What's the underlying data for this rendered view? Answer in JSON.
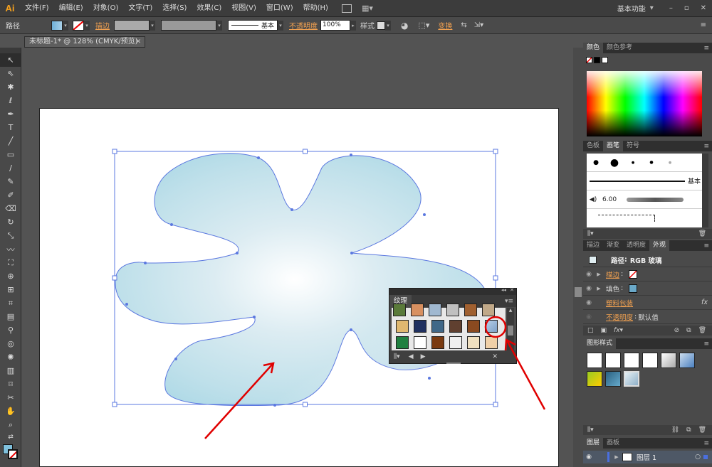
{
  "app": {
    "logo": "Ai",
    "workspace": "基本功能"
  },
  "menu": [
    "文件(F)",
    "编辑(E)",
    "对象(O)",
    "文字(T)",
    "选择(S)",
    "效果(C)",
    "视图(V)",
    "窗口(W)",
    "帮助(H)"
  ],
  "control": {
    "object_type": "路径",
    "stroke_label": "描边",
    "stroke_profile": "基本",
    "opacity_label": "不透明度",
    "opacity_value": "100%",
    "style_label": "样式",
    "transform_label": "变换"
  },
  "document": {
    "tab_title": "未标题-1* @ 128% (CMYK/预览)"
  },
  "color_panel": {
    "tabs": [
      "颜色",
      "颜色参考"
    ]
  },
  "brush_panel": {
    "tabs": [
      "色板",
      "画笔",
      "符号"
    ],
    "basic_label": "基本",
    "size_value": "6.00"
  },
  "appearance_panel": {
    "tabs": [
      "描边",
      "渐变",
      "透明度",
      "外观"
    ],
    "title_label": "路径",
    "title_value": "RGB 玻璃",
    "rows": [
      {
        "label": "描边",
        "value": ""
      },
      {
        "label": "填色",
        "value": ""
      },
      {
        "label": "塑料包装",
        "value": ""
      },
      {
        "label": "不透明度",
        "value": "默认值"
      }
    ],
    "fx": "fx"
  },
  "graphic_styles": {
    "title": "图形样式"
  },
  "layers": {
    "tabs": [
      "图层",
      "画板"
    ],
    "layer_name": "图层 1"
  },
  "texture_panel": {
    "title": "纹理"
  },
  "colors": {
    "accent": "#f0a050",
    "panel": "#4a4a4a",
    "bg": "#535353",
    "annotation": "#e00000",
    "selection": "#4a6fe0"
  }
}
